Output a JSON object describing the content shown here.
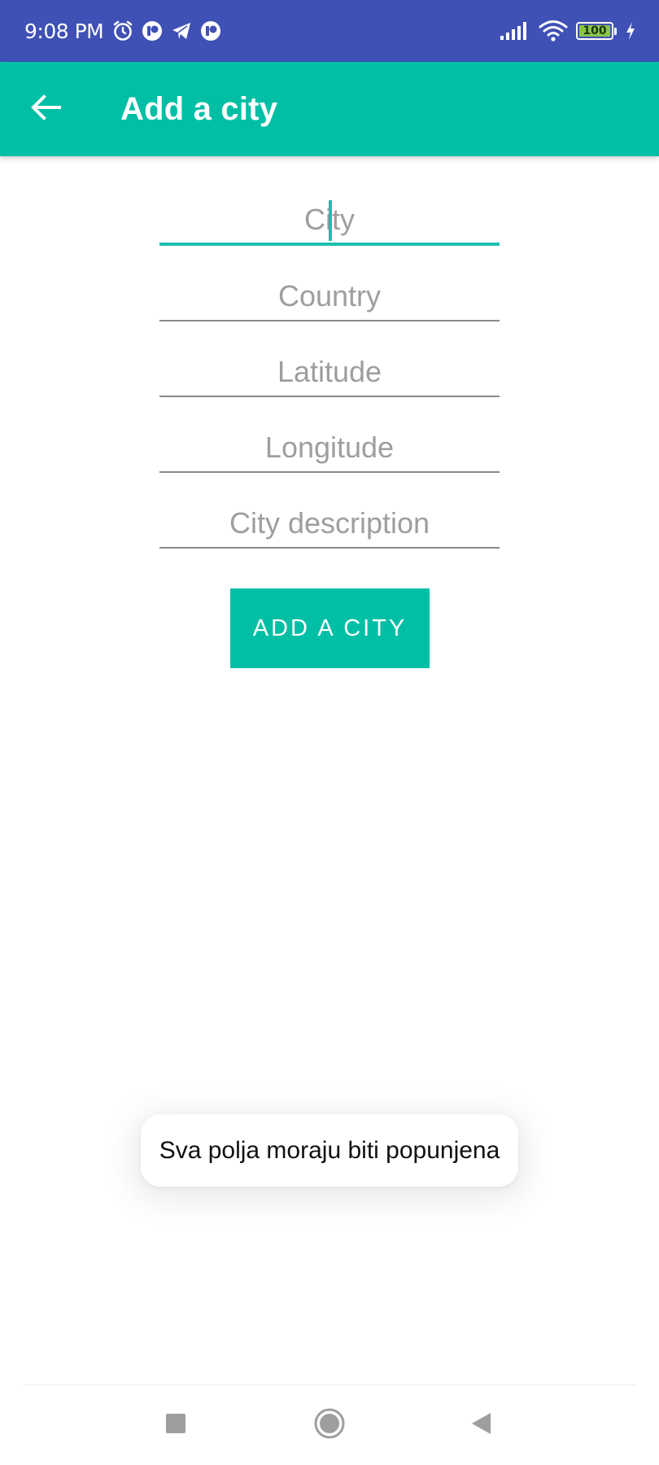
{
  "status_bar": {
    "time": "9:08 PM",
    "battery": "100",
    "icons": [
      "alarm-icon",
      "app-notification-icon",
      "telegram-icon",
      "app-notification-icon",
      "signal-icon",
      "wifi-icon",
      "battery-icon",
      "charging-icon"
    ],
    "color": "#3F51B5"
  },
  "app_bar": {
    "title": "Add a city",
    "back_icon": "arrow-back-icon",
    "color": "#00BFA5"
  },
  "form": {
    "city": {
      "placeholder": "City",
      "value": ""
    },
    "country": {
      "placeholder": "Country",
      "value": ""
    },
    "latitude": {
      "placeholder": "Latitude",
      "value": ""
    },
    "longitude": {
      "placeholder": "Longitude",
      "value": ""
    },
    "description": {
      "placeholder": "City description",
      "value": ""
    },
    "focused_field": "city",
    "accent_color": "#1DBFB0"
  },
  "submit": {
    "label": "ADD A CITY"
  },
  "toast": {
    "message": "Sva polja moraju biti popunjena"
  },
  "nav_bar": {
    "icons": [
      "recents-square-icon",
      "home-circle-icon",
      "back-triangle-icon"
    ]
  }
}
